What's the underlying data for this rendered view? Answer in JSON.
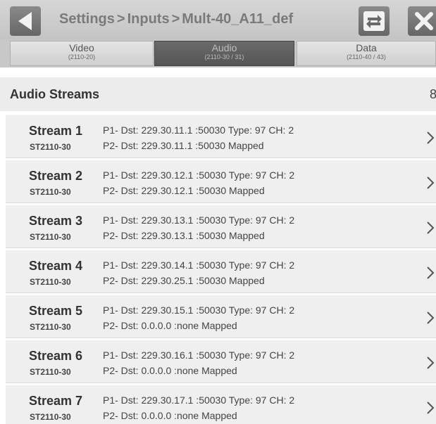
{
  "header": {
    "breadcrumb": [
      "Settings",
      "Inputs",
      "Mult-40_A11_def"
    ],
    "separator": ">"
  },
  "tabs": [
    {
      "label": "Video",
      "sub": "(2110-20)",
      "active": false
    },
    {
      "label": "Audio",
      "sub": "(2110-30 / 31)",
      "active": true
    },
    {
      "label": "Data",
      "sub": "(2110-40 / 43)",
      "active": false
    }
  ],
  "section": {
    "title": "Audio Streams",
    "count": "8"
  },
  "streams": [
    {
      "name": "Stream 1",
      "type": "ST2110-30",
      "p1": "P1- Dst: 229.30.11.1 :50030  Type: 97 CH: 2",
      "p2": "P2- Dst: 229.30.11.1 :50030  Mapped"
    },
    {
      "name": "Stream 2",
      "type": "ST2110-30",
      "p1": "P1- Dst: 229.30.12.1 :50030  Type: 97 CH: 2",
      "p2": "P2- Dst: 229.30.12.1 :50030  Mapped"
    },
    {
      "name": "Stream 3",
      "type": "ST2110-30",
      "p1": "P1- Dst: 229.30.13.1 :50030  Type: 97 CH: 2",
      "p2": "P2- Dst: 229.30.13.1 :50030  Mapped"
    },
    {
      "name": "Stream 4",
      "type": "ST2110-30",
      "p1": "P1- Dst: 229.30.14.1 :50030  Type: 97 CH: 2",
      "p2": "P2- Dst: 229.30.25.1 :50030  Mapped"
    },
    {
      "name": "Stream 5",
      "type": "ST2110-30",
      "p1": "P1- Dst: 229.30.15.1 :50030  Type: 97 CH: 2",
      "p2": "P2- Dst: 0.0.0.0 :none  Mapped"
    },
    {
      "name": "Stream 6",
      "type": "ST2110-30",
      "p1": "P1- Dst: 229.30.16.1 :50030  Type: 97 CH: 2",
      "p2": "P2- Dst: 0.0.0.0 :none  Mapped"
    },
    {
      "name": "Stream 7",
      "type": "ST2110-30",
      "p1": "P1- Dst: 229.30.17.1 :50030  Type: 97 CH: 2",
      "p2": "P2- Dst: 0.0.0.0 :none  Mapped"
    }
  ],
  "icons": {
    "back": "back-arrow-icon",
    "swap": "swap-arrows-icon",
    "close": "close-x-icon",
    "row_chevron": "chevron-right-icon"
  }
}
